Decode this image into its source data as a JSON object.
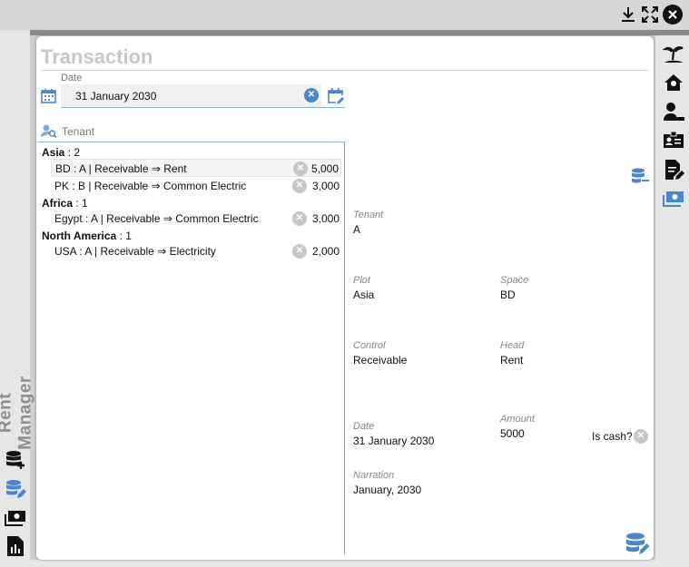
{
  "app": {
    "name": "Rent Manager"
  },
  "window": {
    "icons": [
      "download-icon",
      "fullscreen-icon",
      "close-icon"
    ]
  },
  "title": "Transaction",
  "date_field": {
    "label": "Date",
    "value": "31 January 2030"
  },
  "tenant_search": {
    "placeholder": "Tenant"
  },
  "groups": [
    {
      "name": "Asia",
      "count": "2",
      "rows": [
        {
          "text": "BD : A | Receivable ⇒ Rent",
          "amount": "5,000",
          "selected": true
        },
        {
          "text": "PK : B | Receivable ⇒ Common Electric",
          "amount": "3,000"
        }
      ]
    },
    {
      "name": "Africa",
      "count": "1",
      "rows": [
        {
          "text": "Egypt : A | Receivable ⇒ Common Electric",
          "amount": "3,000"
        }
      ]
    },
    {
      "name": "North America",
      "count": "1",
      "rows": [
        {
          "text": "USA : A | Receivable ⇒ Electricity",
          "amount": "2,000"
        }
      ]
    }
  ],
  "details": {
    "tenant": {
      "label": "Tenant",
      "value": "A"
    },
    "plot": {
      "label": "Plot",
      "value": "Asia"
    },
    "space": {
      "label": "Space",
      "value": "BD"
    },
    "control": {
      "label": "Control",
      "value": "Receivable"
    },
    "head": {
      "label": "Head",
      "value": "Rent"
    },
    "date": {
      "label": "Date",
      "value": "31 January 2030"
    },
    "amount": {
      "label": "Amount",
      "value": "5000"
    },
    "is_cash": {
      "label": "Is cash?"
    },
    "narration": {
      "label": "Narration",
      "value": "January, 2030"
    }
  },
  "colors": {
    "accent": "#4a86d0",
    "title": "#c8c8c8",
    "icon": "#111111"
  }
}
